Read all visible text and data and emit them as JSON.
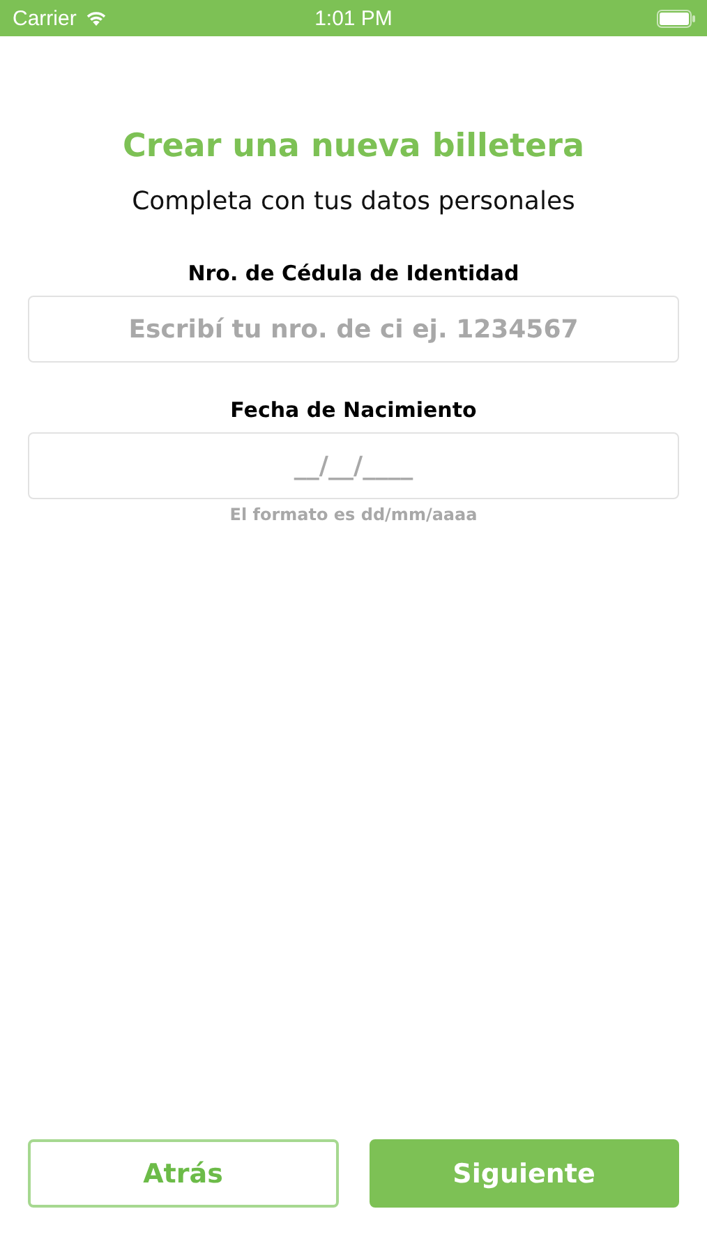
{
  "status_bar": {
    "carrier": "Carrier",
    "time": "1:01 PM"
  },
  "title": "Crear una nueva billetera",
  "subtitle": "Completa con tus datos personales",
  "fields": [
    {
      "label": "Nro. de Cédula de Identidad",
      "placeholder": "Escribí tu nro. de ci ej. 1234567"
    },
    {
      "label": "Fecha de Nacimiento",
      "placeholder": "__/__/____",
      "hint": "El formato es dd/mm/aaaa"
    }
  ],
  "buttons": [
    {
      "label": "Atrás",
      "kind": "outline"
    },
    {
      "label": "Siguiente",
      "kind": "filled"
    }
  ]
}
